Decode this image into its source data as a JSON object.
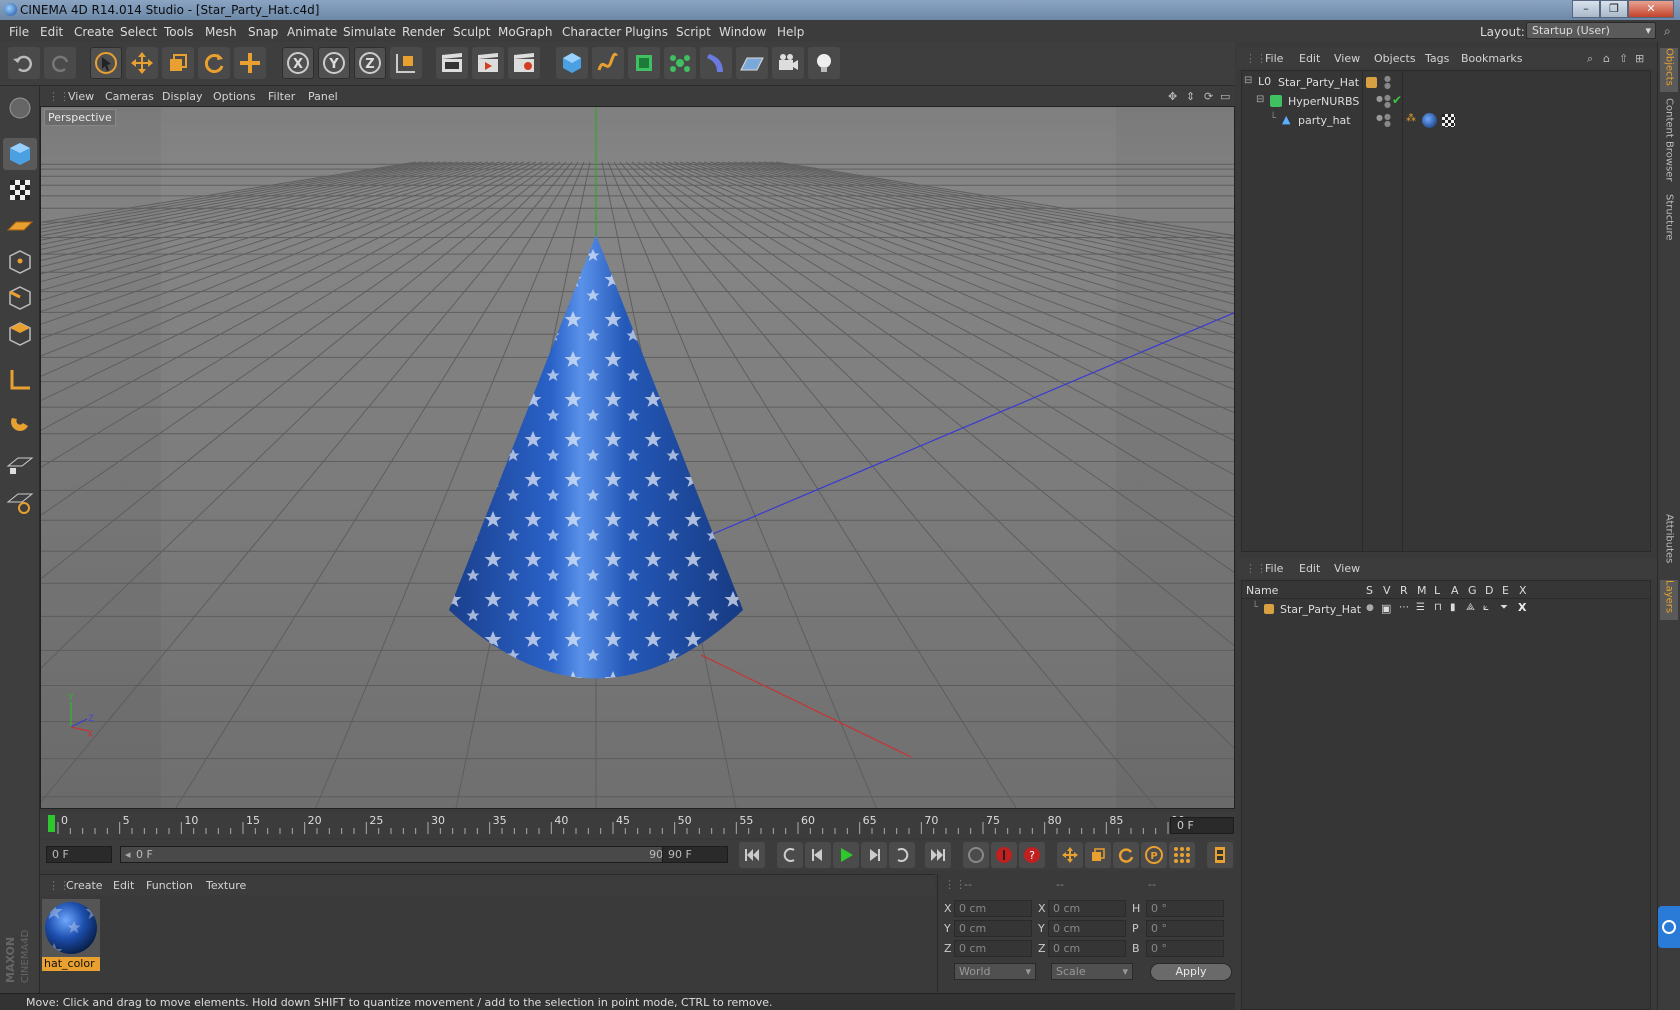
{
  "window": {
    "title": "CINEMA 4D R14.014 Studio - [Star_Party_Hat.c4d]",
    "controls": [
      "–",
      "❐",
      "✕"
    ]
  },
  "menu": {
    "items": [
      "File",
      "Edit",
      "Create",
      "Select",
      "Tools",
      "Mesh",
      "Snap",
      "Animate",
      "Simulate",
      "Render",
      "Sculpt",
      "MoGraph",
      "Character",
      "Plugins",
      "Script",
      "Window",
      "Help"
    ],
    "layout_label": "Layout:",
    "layout_value": "Startup (User)"
  },
  "viewport": {
    "menu": [
      "View",
      "Cameras",
      "Display",
      "Options",
      "Filter",
      "Panel"
    ],
    "label": "Perspective"
  },
  "timeline": {
    "ticks": [
      "0",
      "5",
      "10",
      "15",
      "20",
      "25",
      "30",
      "35",
      "40",
      "45",
      "50",
      "55",
      "60",
      "65",
      "70",
      "75",
      "80",
      "85",
      "90"
    ],
    "current_frame": "0 F",
    "start_field": "0 F",
    "range_start": "0 F",
    "range_end": "90 F",
    "end_field": "90 F"
  },
  "material_manager": {
    "menu": [
      "Create",
      "Edit",
      "Function",
      "Texture"
    ],
    "material_name": "hat_color"
  },
  "coordinates": {
    "headers": [
      "--",
      "--",
      "--"
    ],
    "pos": [
      {
        "axis": "X",
        "value": "0 cm"
      },
      {
        "axis": "Y",
        "value": "0 cm"
      },
      {
        "axis": "Z",
        "value": "0 cm"
      }
    ],
    "size": [
      {
        "axis": "X",
        "value": "0 cm"
      },
      {
        "axis": "Y",
        "value": "0 cm"
      },
      {
        "axis": "Z",
        "value": "0 cm"
      }
    ],
    "rot": [
      {
        "axis": "H",
        "value": "0 °"
      },
      {
        "axis": "P",
        "value": "0 °"
      },
      {
        "axis": "B",
        "value": "0 °"
      }
    ],
    "mode_world": "World",
    "mode_scale": "Scale",
    "apply_label": "Apply"
  },
  "status": {
    "text": "Move: Click and drag to move elements. Hold down SHIFT to quantize movement / add to the selection in point mode, CTRL to remove."
  },
  "object_manager": {
    "menu": [
      "File",
      "Edit",
      "View",
      "Objects",
      "Tags",
      "Bookmarks"
    ],
    "objects": [
      {
        "name": "Star_Party_Hat"
      },
      {
        "name": "HyperNURBS"
      },
      {
        "name": "party_hat"
      }
    ]
  },
  "layer_manager": {
    "menu": [
      "File",
      "Edit",
      "View"
    ],
    "columns": [
      "Name",
      "S",
      "V",
      "R",
      "M",
      "L",
      "A",
      "G",
      "D",
      "E",
      "X"
    ],
    "layers": [
      {
        "name": "Star_Party_Hat"
      }
    ]
  },
  "side_tabs": [
    "Objects",
    "Content Browser",
    "Structure",
    "Attributes",
    "Layers"
  ],
  "colors": {
    "accent": "#e8a030",
    "hat_blue": "#1f56b8",
    "axis_x": "#c83232",
    "axis_y": "#2eb82e",
    "axis_z": "#3a3ad0"
  }
}
